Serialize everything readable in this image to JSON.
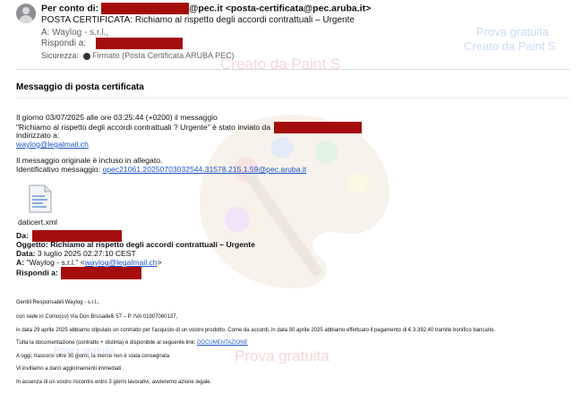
{
  "header": {
    "sender_prefix": "Per conto di:",
    "sender_domain": "@pec.it",
    "sender_address": "<posta-certificata@pec.aruba.it>",
    "subject": "POSTA CERTIFICATA: Richiamo al rispetto degli accordi contrattuali – Urgente",
    "to_label": "A:",
    "to_value": "Waylog - s.r.l.,",
    "reply_label": "Rispondi a:",
    "security_label": "Sicurezza:",
    "security_value": "Firmato (Posta Certificata ARUBA PEC)"
  },
  "watermarks": {
    "top_right_1": "Prova gratuita",
    "top_right_2": "Creato da Paint S",
    "center_top": "Creato da Paint S",
    "bottom_left": "Prova gratuita",
    "bottom_center": "Prova gratuita"
  },
  "message": {
    "title": "Messaggio di posta certificata",
    "line1": "Il giorno 03/07/2025 alle ore 03:25:44 (+0200) il messaggio",
    "line2": "\"Richiamo al rispetto degli accordi contrattuali ? Urgente\" è stato inviato da",
    "line3": "indirizzato a:",
    "recipient_link": "waylog@legalmail.ch",
    "line4": "Il messaggio originale è incluso in allegato.",
    "msgid_label": "Identificativo messaggio:",
    "msgid_link": "opec21061.20250703032544.31578.215.1.59@pec.aruba.it"
  },
  "attachment": {
    "icon": "xml-file-icon",
    "name": "daticert.xml"
  },
  "original": {
    "from_label": "Da:",
    "subject_label": "Oggetto:",
    "subject_value": "Richiamo al rispetto degli accordi contrattuali – Urgente",
    "date_label": "Data:",
    "date_value": "3 luglio 2025 02:27:10 CEST",
    "to_label": "A:",
    "to_value": "\"Waylog - s.r.l.\" <",
    "to_link": "waylog@legalmail.ch",
    "to_end": ">",
    "reply_label": "Rispondi a:"
  },
  "letter": {
    "l1": "Gentili Responsabili  Waylog - s.r.l.,",
    "l2": "con sede in Como(co) Via Don Brusadelli 57    – P. IVA  01907080137,",
    "l3": "in data 29 aprile 2025 abbiamo stipulato un contratto per l'acquisto di un vostro prodotto. Come da accordi, in data 30 aprile 2025 abbiamo effettuato il pagamento di € 3.392,40 tramite bonifico bancario.",
    "l4_text": "Tutta la documentazione (contratto + distinta) è disponibile al seguente link: ",
    "l4_link": "DOCUMENTAZIONE",
    "l5": "A oggi, trascorsi oltre 30 giorni, la merce non è stata consegnata.",
    "l6": "Vi  invitiamo a darci aggiornamenti immediati .",
    "l7": "In assenza di un vostro riscontro entro 3 giorni lavorativi, avvieremo azione legale."
  }
}
